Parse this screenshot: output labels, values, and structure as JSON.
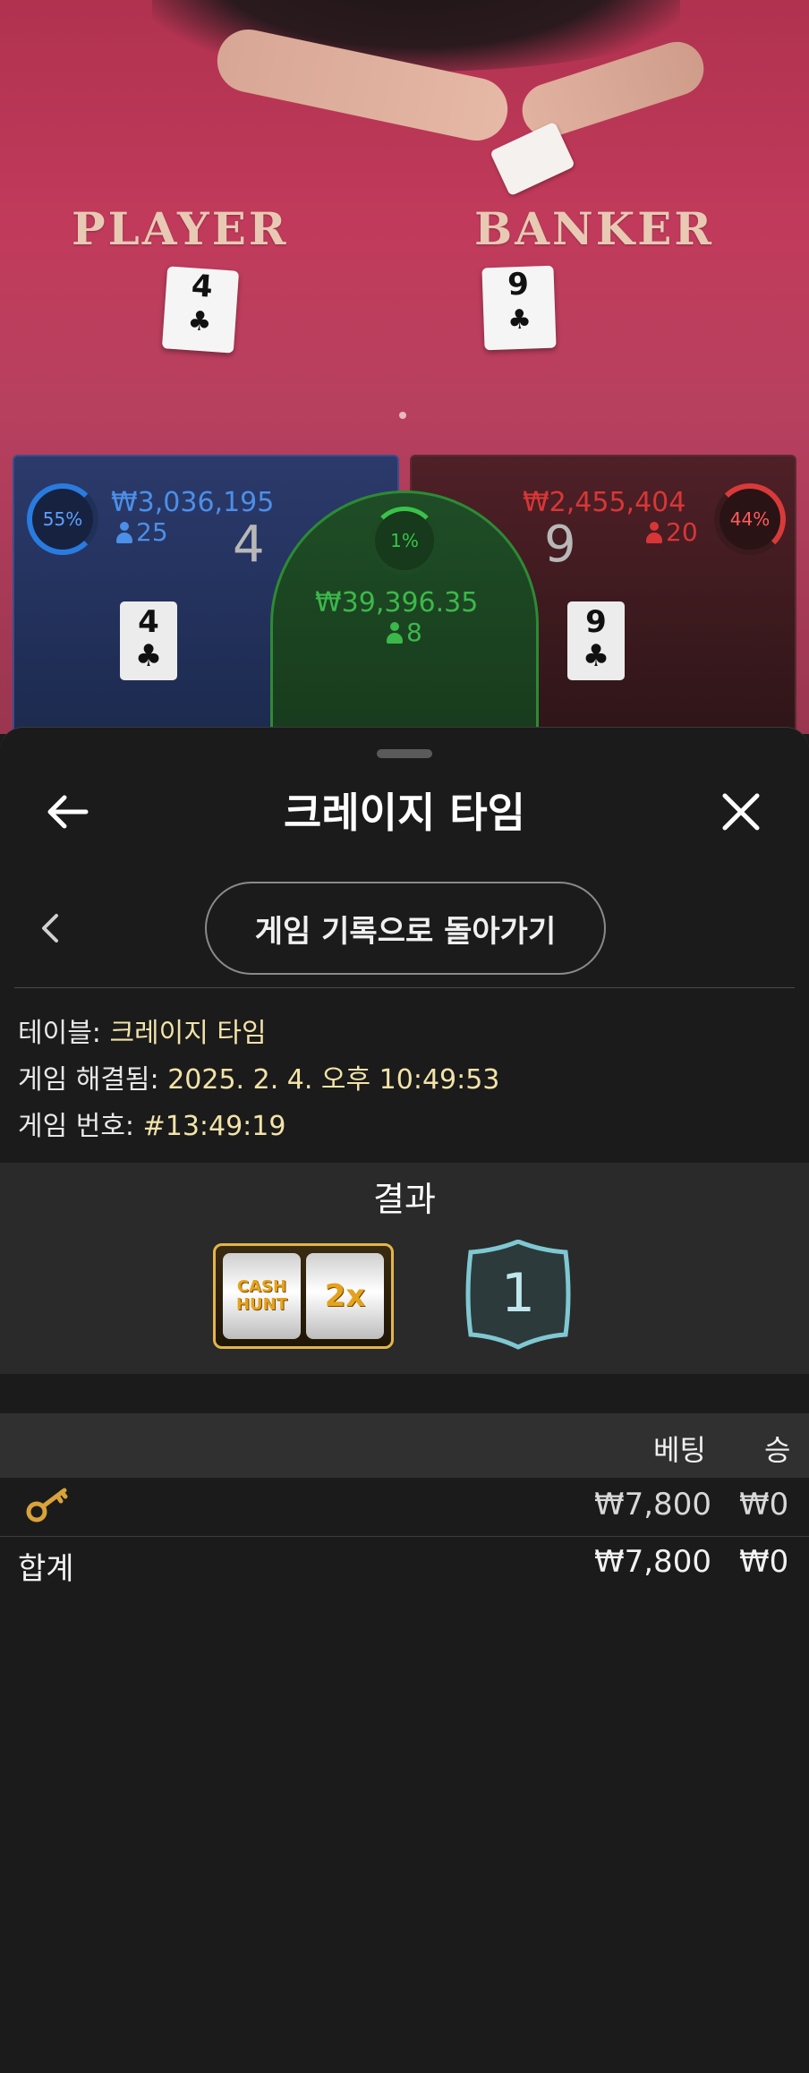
{
  "table_felt": {
    "player_label": "PLAYER",
    "banker_label": "BANKER",
    "player_card": "4",
    "banker_card": "9"
  },
  "bets": {
    "player": {
      "percent": "55%",
      "amount": "₩3,036,195",
      "players": "25",
      "score": "4",
      "card": "4",
      "suit": "♣"
    },
    "tie": {
      "percent": "1%",
      "amount": "₩39,396.35",
      "players": "8"
    },
    "banker": {
      "percent": "44%",
      "amount": "₩2,455,404",
      "players": "20",
      "score": "9",
      "card": "9",
      "suit": "♣"
    }
  },
  "sheet": {
    "title": "크레이지 타임",
    "back_to_history": "게임 기록으로 돌아가기",
    "info": {
      "table_label": "테이블: ",
      "table_value": "크레이지 타임",
      "resolved_label": "게임 해결됨: ",
      "resolved_value": "2025. 2. 4. 오후 10:49:53",
      "number_label": "게임 번호: ",
      "number_value": "#13:49:19"
    },
    "results": {
      "title": "결과",
      "slot_left": "CASH HUNT",
      "slot_right": "2x",
      "segment": "1"
    },
    "bets_table": {
      "headers": {
        "bet": "베팅",
        "win": "승"
      },
      "rows": [
        {
          "icon": "key-icon",
          "bet": "₩7,800",
          "win": "₩0"
        }
      ],
      "total": {
        "label": "합계",
        "bet": "₩7,800",
        "win": "₩0"
      }
    }
  },
  "colors": {
    "player": "#4c8fe8",
    "banker": "#d83636",
    "tie": "#3cb84a",
    "gold": "#e3b64a"
  }
}
